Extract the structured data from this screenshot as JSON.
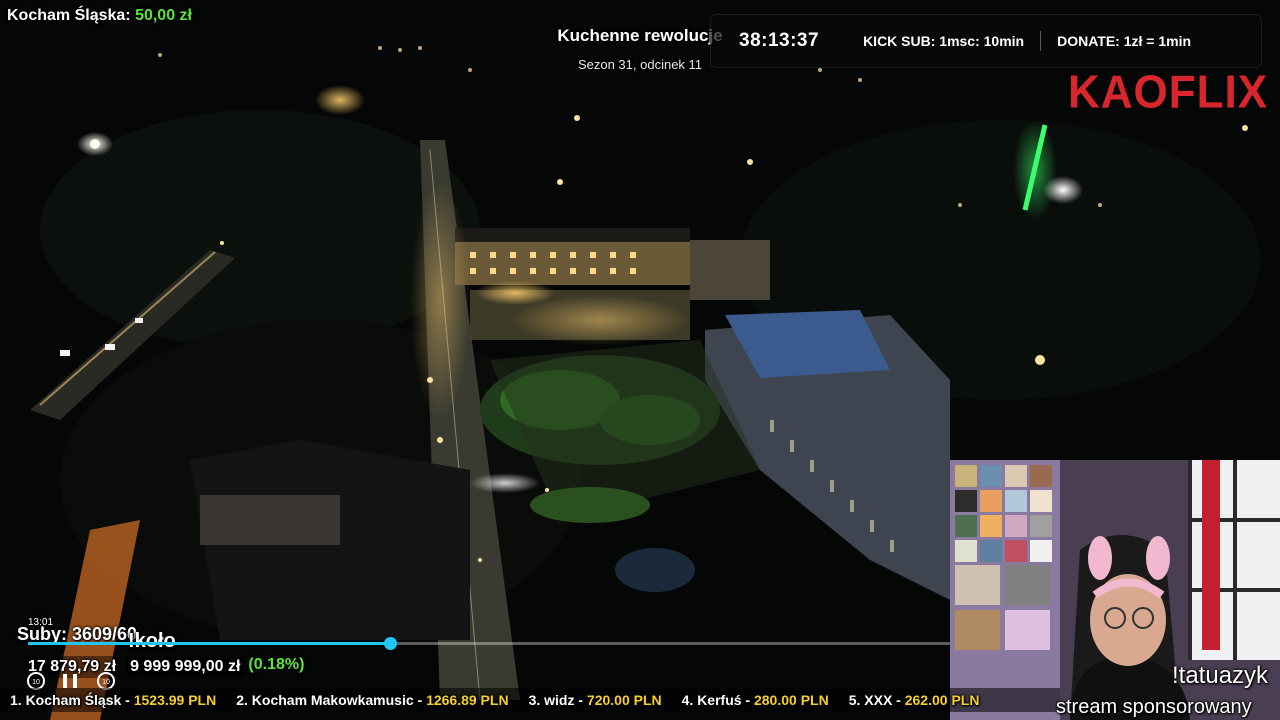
{
  "top_left": {
    "label": "Kocham Śląska:",
    "amount": "50,00 zł"
  },
  "episode": {
    "title": "Kuchenne rewolucje",
    "subtitle": "Sezon 31, odcinek 11"
  },
  "topbar": {
    "timer": "38:13:37",
    "kick_sub": "KICK SUB: 1msc: 10min",
    "donate": "DONATE: 1zł = 1min"
  },
  "logo": "KAOFLIX",
  "player": {
    "time": "13:01",
    "subs": "Suby: 3609/60",
    "command": "!koło",
    "progress": 0.393,
    "raised": "17 879,79 zł",
    "goal": "9 999 999,00 zł",
    "goal_pct": "(0.18%)"
  },
  "ticker": [
    {
      "rank": "1.",
      "name": "Kocham Śląsk",
      "value": "1523.99 PLN"
    },
    {
      "rank": "2.",
      "name": "Kocham Makowkamusic",
      "value": "1266.89 PLN"
    },
    {
      "rank": "3.",
      "name": "widz",
      "value": "720.00 PLN"
    },
    {
      "rank": "4.",
      "name": "Kerfuś",
      "value": "280.00 PLN"
    },
    {
      "rank": "5.",
      "name": "XXX",
      "value": "262.00 PLN"
    }
  ],
  "webcam": {
    "command": "!tatuazyk",
    "sponsor": "stream sponsorowany"
  },
  "colors": {
    "accent_green": "#5ee33a",
    "accent_blue": "#21c7f4",
    "logo_red": "#d8262c",
    "ticker_value": "#f6cf2a"
  }
}
